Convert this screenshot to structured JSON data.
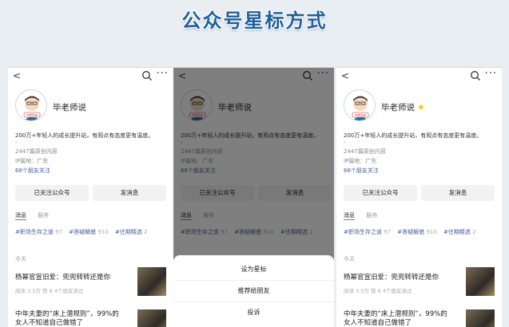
{
  "header": {
    "title": "公众号星标方式"
  },
  "account": {
    "name": "毕老师说",
    "avatar_badge": "毕老师说",
    "description": "200万+年轻人的成长提升站，有观点有态度更有温度。",
    "dash": "-",
    "original_count": "2447篇原创内容",
    "ip_location": "IP属地：广东",
    "friends_following": "66个朋友关注",
    "followed_button": "已关注公众号",
    "message_button": "发消息"
  },
  "tabs": {
    "messages": "消息",
    "services": "服务"
  },
  "hashtags": [
    {
      "label": "#职场生存之道",
      "count": "97"
    },
    {
      "label": "#答疑解惑",
      "count": "910"
    },
    {
      "label": "#往期精选",
      "count": "2"
    }
  ],
  "feed": {
    "section_label": "今天",
    "articles": [
      {
        "title": "杨幂官宣旧爱：兜兜转转还是你",
        "meta": "阅读 3.5万  赞 8  4个朋友读过"
      },
      {
        "title_line1": "中年夫妻的“床上潜规则”，99%的",
        "title_line2": "女人不知道自己做错了"
      }
    ]
  },
  "sheet": {
    "set_star": "设为星标",
    "recommend": "推荐给朋友",
    "report": "投诉"
  },
  "icons": {
    "back": "back-arrow-icon",
    "search": "search-icon",
    "more": "more-icon",
    "star": "star-icon"
  },
  "colors": {
    "title": "#1f5f9a",
    "link": "#4a5f98",
    "star": "#f3c323",
    "tab_underline": "#2aae67"
  }
}
